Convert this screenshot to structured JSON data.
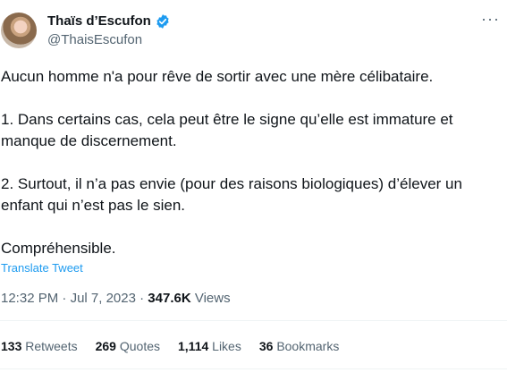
{
  "author": {
    "display_name": "Thaïs d’Escufon",
    "handle": "@ThaisEscufon"
  },
  "tweet": {
    "paragraphs": [
      "Aucun homme n'a pour rêve de sortir avec une mère célibataire.",
      "1. Dans certains cas, cela peut être le signe qu’elle est immature et manque de discernement.",
      "2. Surtout, il n’a pas envie (pour des raisons biologiques) d’élever un enfant qui n’est pas le sien.",
      "Compréhensible."
    ],
    "translate_label": "Translate Tweet"
  },
  "meta": {
    "time": "12:32 PM",
    "date": "Jul 7, 2023",
    "views_count": "347.6K",
    "views_label": "Views"
  },
  "stats": {
    "retweets_count": "133",
    "retweets_label": "Retweets",
    "quotes_count": "269",
    "quotes_label": "Quotes",
    "likes_count": "1,114",
    "likes_label": "Likes",
    "bookmarks_count": "36",
    "bookmarks_label": "Bookmarks"
  },
  "colors": {
    "accent": "#1d9bf0",
    "text_primary": "#0f1419",
    "text_secondary": "#536471",
    "divider": "#eff3f4"
  },
  "icons": {
    "verified": "verified-badge-icon",
    "more": "more-options-icon"
  }
}
